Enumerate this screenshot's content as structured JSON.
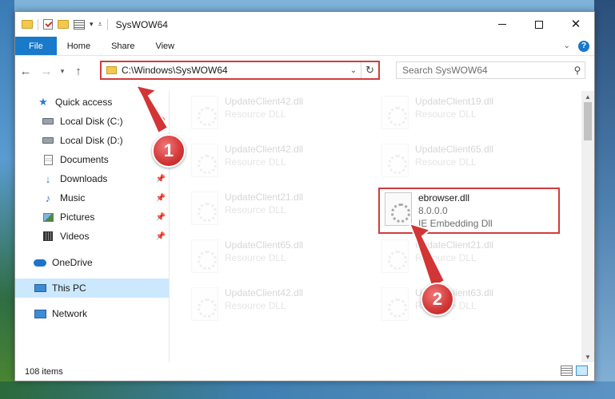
{
  "window": {
    "title": "SysWOW64"
  },
  "ribbon": {
    "tabs": [
      "File",
      "Home",
      "Share",
      "View"
    ],
    "help": "?"
  },
  "address": {
    "path": "C:\\Windows\\SysWOW64"
  },
  "search": {
    "placeholder": "Search SysWOW64"
  },
  "sidebar": {
    "items": [
      {
        "label": "Quick access",
        "icon": "star-icon"
      },
      {
        "label": "Local Disk (C:)",
        "icon": "disk-icon"
      },
      {
        "label": "Local Disk (D:)",
        "icon": "disk-icon"
      },
      {
        "label": "Documents",
        "icon": "documents-icon"
      },
      {
        "label": "Downloads",
        "icon": "downloads-icon"
      },
      {
        "label": "Music",
        "icon": "music-icon"
      },
      {
        "label": "Pictures",
        "icon": "pictures-icon"
      },
      {
        "label": "Videos",
        "icon": "videos-icon"
      },
      {
        "label": "OneDrive",
        "icon": "onedrive-icon"
      },
      {
        "label": "This PC",
        "icon": "this-pc-icon"
      },
      {
        "label": "Network",
        "icon": "network-icon"
      }
    ]
  },
  "files": {
    "col1": [
      {
        "name": "UpdateClient42.dll",
        "type": "Resource DLL"
      },
      {
        "name": "UpdateClient42.dll",
        "type": "Resource DLL"
      },
      {
        "name": "UpdateClient21.dll",
        "type": "Resource DLL"
      },
      {
        "name": "UpdateClient65.dll",
        "type": "Resource DLL"
      },
      {
        "name": "UpdateClient42.dll",
        "type": "Resource DLL"
      }
    ],
    "col2": [
      {
        "name": "UpdateClient19.dll",
        "type": "Resource DLL"
      },
      {
        "name": "UpdateClient65.dll",
        "type": "Resource DLL"
      },
      {
        "name": "ebrowser.dll",
        "version": "8.0.0.0",
        "description": "IE Embedding Dll"
      },
      {
        "name": "UpdateClient21.dll",
        "type": "Resource DLL"
      },
      {
        "name": "UpdateClient63.dll",
        "type": "Resource DLL"
      }
    ]
  },
  "status": {
    "count": "108 items"
  },
  "callouts": {
    "one": "1",
    "two": "2"
  },
  "colors": {
    "accent": "#1979ca",
    "highlight": "#d23b3b",
    "selected": "#cce8ff"
  }
}
